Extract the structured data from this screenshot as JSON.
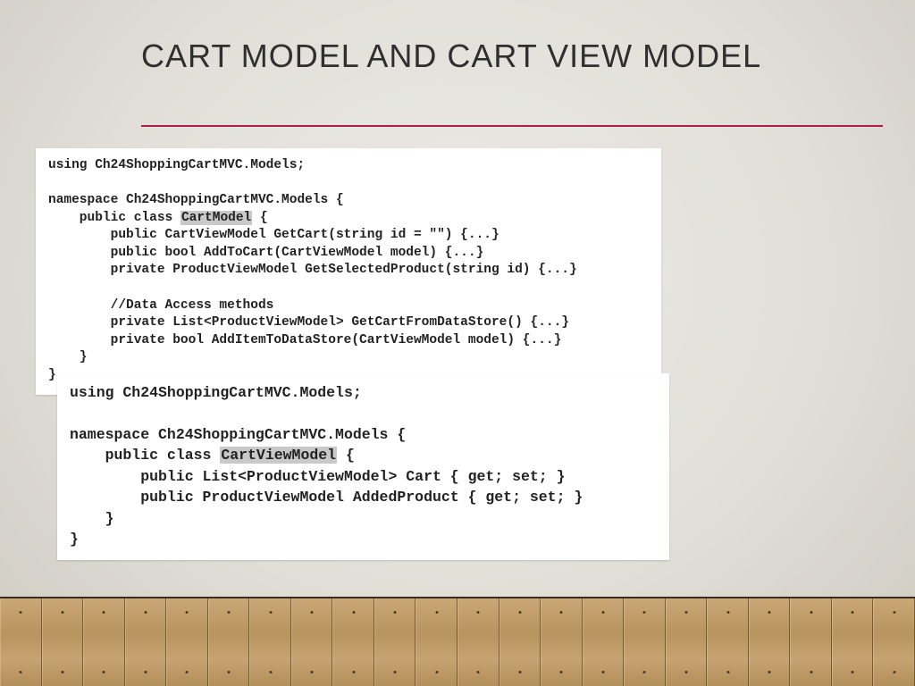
{
  "title": "CART MODEL AND CART VIEW MODEL",
  "code1": {
    "l1": "using Ch24ShoppingCartMVC.Models;",
    "l2": "",
    "l3": "namespace Ch24ShoppingCartMVC.Models {",
    "l4a": "    public class ",
    "l4h": "CartModel",
    "l4b": " {",
    "l5": "        public CartViewModel GetCart(string id = \"\") {...}",
    "l6": "        public bool AddToCart(CartViewModel model) {...}",
    "l7": "        private ProductViewModel GetSelectedProduct(string id) {...}",
    "l8": "",
    "l9": "        //Data Access methods",
    "l10": "        private List<ProductViewModel> GetCartFromDataStore() {...}",
    "l11": "        private bool AddItemToDataStore(CartViewModel model) {...}",
    "l12": "    }",
    "l13": "}"
  },
  "code2": {
    "l1": "using Ch24ShoppingCartMVC.Models;",
    "l2": "",
    "l3": "namespace Ch24ShoppingCartMVC.Models {",
    "l4a": "    public class ",
    "l4h": "CartViewModel",
    "l4b": " {",
    "l5": "        public List<ProductViewModel> Cart { get; set; }",
    "l6": "        public ProductViewModel AddedProduct { get; set; }",
    "l7": "    }",
    "l8": "}"
  }
}
